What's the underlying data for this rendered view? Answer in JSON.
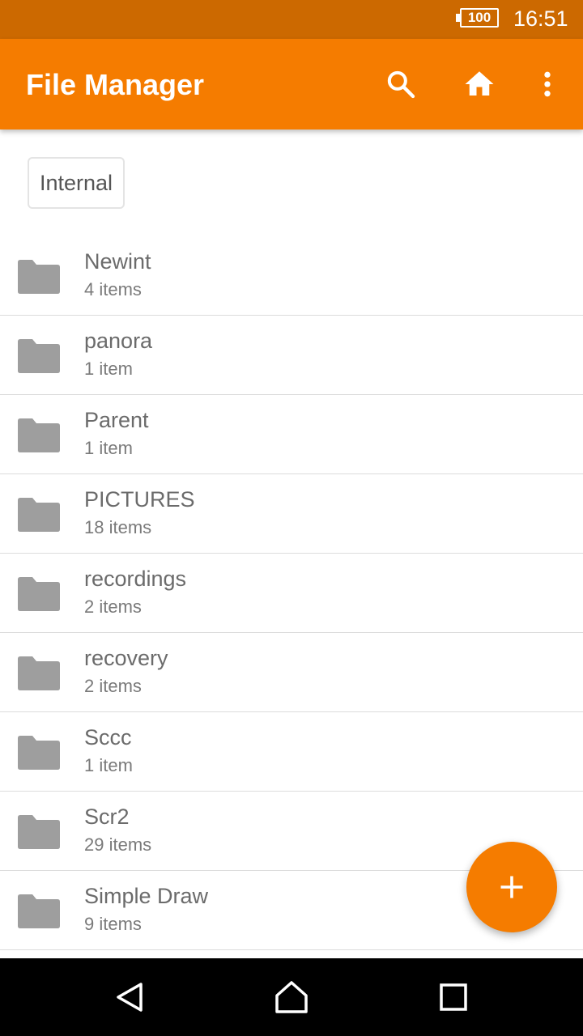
{
  "status_bar": {
    "battery": "100",
    "time": "16:51"
  },
  "app_bar": {
    "title": "File Manager",
    "icons": [
      "search-icon",
      "home-icon",
      "more-vert-icon"
    ]
  },
  "storage": {
    "selected": "Internal"
  },
  "files": [
    {
      "name": "Newint",
      "count": "4 items"
    },
    {
      "name": "panora",
      "count": "1 item"
    },
    {
      "name": "Parent",
      "count": "1 item"
    },
    {
      "name": "PICTURES",
      "count": "18 items"
    },
    {
      "name": "recordings",
      "count": "2 items"
    },
    {
      "name": "recovery",
      "count": "2 items"
    },
    {
      "name": "Sccc",
      "count": "1 item"
    },
    {
      "name": "Scr2",
      "count": "29 items"
    },
    {
      "name": "Simple Draw",
      "count": "9 items"
    }
  ],
  "fab": {
    "icon": "plus-icon"
  },
  "nav": {
    "icons": [
      "back-icon",
      "home-nav-icon",
      "recents-icon"
    ]
  },
  "colors": {
    "primary": "#f57c00",
    "status_bar": "#cc6900",
    "folder": "#9e9e9e",
    "text_primary": "#6b6b6b"
  }
}
